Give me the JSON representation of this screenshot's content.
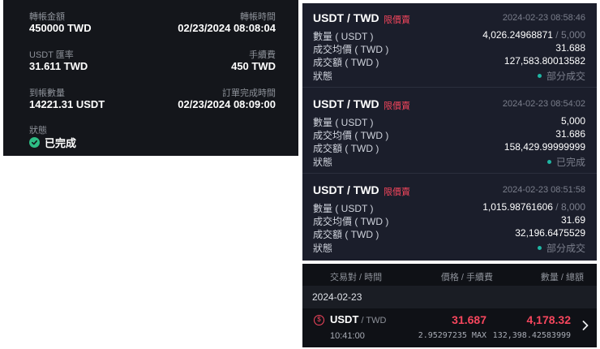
{
  "transfer": {
    "amount_label": "轉帳金額",
    "amount_value": "450000 TWD",
    "time_label": "轉帳時間",
    "time_value": "02/23/2024 08:08:04",
    "rate_label": "USDT 匯率",
    "rate_value": "31.611 TWD",
    "fee_label": "手續費",
    "fee_value": "450 TWD",
    "received_label": "到帳數量",
    "received_value": "14221.31 USDT",
    "completed_label": "訂單完成時間",
    "completed_value": "02/23/2024 08:09:00",
    "status_label": "狀態",
    "status_value": "已完成",
    "status_icon": "check-circle-icon",
    "status_color": "#2ebd85"
  },
  "orders": [
    {
      "pair": "USDT / TWD",
      "type": "限價賣",
      "time": "2024-02-23 08:58:46",
      "qty_label": "數量 ( USDT )",
      "qty_filled": "4,026.24968871",
      "qty_total": " / 5,000",
      "avg_label": "成交均價 ( TWD )",
      "avg_value": "31.688",
      "amount_label": "成交額 ( TWD )",
      "amount_value": "127,583.80013582",
      "status_label": "狀態",
      "status_value": "部分成交"
    },
    {
      "pair": "USDT / TWD",
      "type": "限價賣",
      "time": "2024-02-23 08:54:02",
      "qty_label": "數量 ( USDT )",
      "qty_filled": "5,000",
      "qty_total": "",
      "avg_label": "成交均價 ( TWD )",
      "avg_value": "31.686",
      "amount_label": "成交額 ( TWD )",
      "amount_value": "158,429.99999999",
      "status_label": "狀態",
      "status_value": "已完成"
    },
    {
      "pair": "USDT / TWD",
      "type": "限價賣",
      "time": "2024-02-23 08:51:58",
      "qty_label": "數量 ( USDT )",
      "qty_filled": "1,015.98761606",
      "qty_total": " / 8,000",
      "avg_label": "成交均價 ( TWD )",
      "avg_value": "31.69",
      "amount_label": "成交額 ( TWD )",
      "amount_value": "32,196.6475529",
      "status_label": "狀態",
      "status_value": "部分成交"
    }
  ],
  "history": {
    "col_pair": "交易對 / 時間",
    "col_price": "價格 / 手續費",
    "col_qty": "數量 / 總額",
    "date": "2024-02-23",
    "trade": {
      "base": "USDT",
      "quote": " / TWD",
      "time": "10:41:00",
      "price": "31.687",
      "fee": "2.95297235 MAX",
      "qty": "4,178.32",
      "total": "132,398.42583999",
      "coin_icon": "coin-icon",
      "chevron_icon": "chevron-right-icon"
    }
  },
  "colors": {
    "sell": "#f6465d",
    "success": "#2ebd85",
    "status_dot": "#1fb6a4"
  }
}
